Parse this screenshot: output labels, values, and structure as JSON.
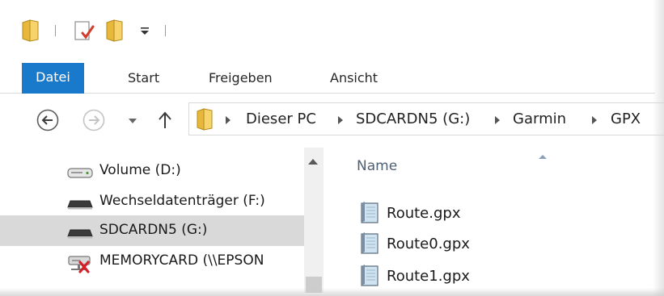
{
  "ribbon": {
    "tabs": [
      {
        "label": "Datei",
        "active": true
      },
      {
        "label": "Start"
      },
      {
        "label": "Freigeben"
      },
      {
        "label": "Ansicht"
      }
    ]
  },
  "address_bar": {
    "crumbs": [
      "Dieser PC",
      "SDCARDN5 (G:)",
      "Garmin",
      "GPX"
    ]
  },
  "nav_pane": {
    "items": [
      {
        "label": "Volume (D:)",
        "icon": "hard-drive-icon"
      },
      {
        "label": "Wechseldatenträger (F:)",
        "icon": "removable-drive-icon"
      },
      {
        "label": "SDCARDN5 (G:)",
        "icon": "removable-drive-icon",
        "selected": true
      },
      {
        "label": "MEMORYCARD (\\\\EPSON",
        "icon": "disconnected-network-drive-icon"
      }
    ]
  },
  "content": {
    "column_header": "Name",
    "files": [
      {
        "name": "Route.gpx"
      },
      {
        "name": "Route0.gpx"
      },
      {
        "name": "Route1.gpx"
      }
    ]
  },
  "colors": {
    "file_tab": "#1979ca",
    "selection": "#d9d9d9",
    "header_text": "#4f6075"
  }
}
